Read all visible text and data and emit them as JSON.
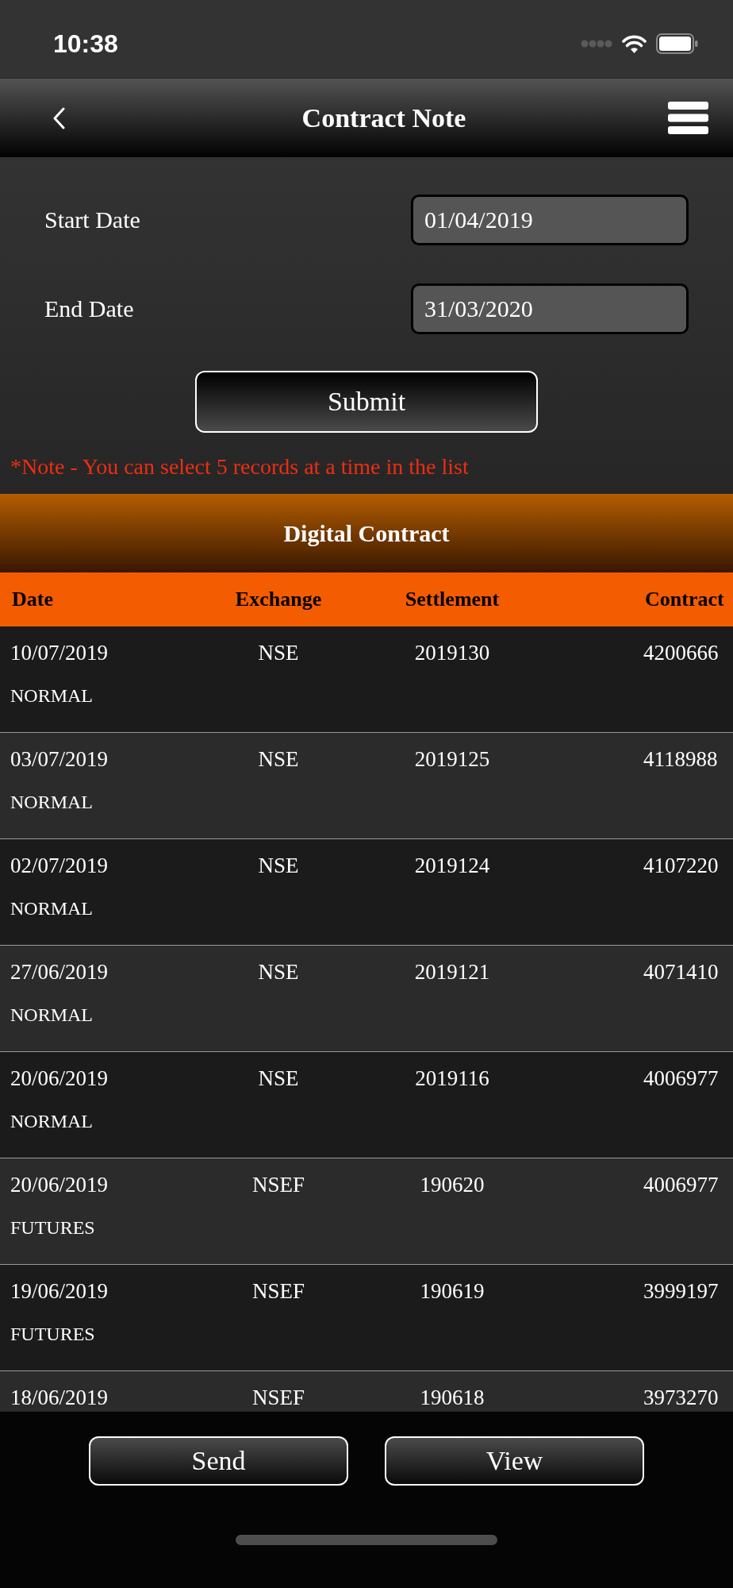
{
  "status_bar": {
    "time": "10:38"
  },
  "nav": {
    "title": "Contract Note"
  },
  "form": {
    "fields": [
      {
        "label": "Start Date",
        "value": "01/04/2019"
      },
      {
        "label": "End Date",
        "value": "31/03/2020"
      }
    ],
    "submit": "Submit",
    "note": "*Note - You can select 5 records at a time in the list"
  },
  "section": {
    "title": "Digital Contract"
  },
  "table": {
    "columns": [
      "Date",
      "Exchange",
      "Settlement",
      "Contract"
    ],
    "rows": [
      {
        "date": "10/07/2019",
        "exchange": "NSE",
        "settlement": "2019130",
        "contract": "4200666",
        "type": "NORMAL"
      },
      {
        "date": "03/07/2019",
        "exchange": "NSE",
        "settlement": "2019125",
        "contract": "4118988",
        "type": "NORMAL"
      },
      {
        "date": "02/07/2019",
        "exchange": "NSE",
        "settlement": "2019124",
        "contract": "4107220",
        "type": "NORMAL"
      },
      {
        "date": "27/06/2019",
        "exchange": "NSE",
        "settlement": "2019121",
        "contract": "4071410",
        "type": "NORMAL"
      },
      {
        "date": "20/06/2019",
        "exchange": "NSE",
        "settlement": "2019116",
        "contract": "4006977",
        "type": "NORMAL"
      },
      {
        "date": "20/06/2019",
        "exchange": "NSEF",
        "settlement": "190620",
        "contract": "4006977",
        "type": "FUTURES"
      },
      {
        "date": "19/06/2019",
        "exchange": "NSEF",
        "settlement": "190619",
        "contract": "3999197",
        "type": "FUTURES"
      },
      {
        "date": "18/06/2019",
        "exchange": "NSEF",
        "settlement": "190618",
        "contract": "3973270"
      }
    ]
  },
  "buttons": [
    "Send",
    "View"
  ]
}
